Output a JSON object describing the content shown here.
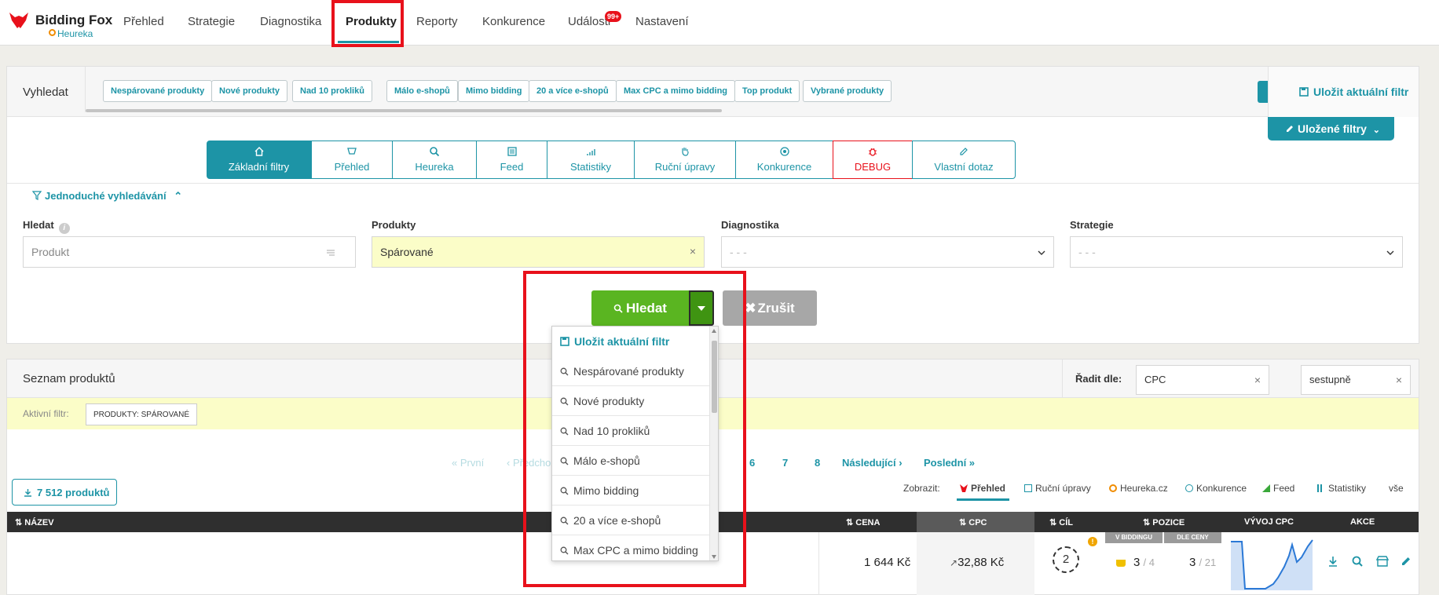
{
  "brand": {
    "name": "Bidding Fox",
    "sub": "Heureka",
    "color": "#e8111b"
  },
  "nav": {
    "items": [
      {
        "label": "Přehled"
      },
      {
        "label": "Strategie"
      },
      {
        "label": "Diagnostika"
      },
      {
        "label": "Produkty"
      },
      {
        "label": "Reporty"
      },
      {
        "label": "Konkurence"
      },
      {
        "label": "Události"
      },
      {
        "label": "Nastavení"
      }
    ],
    "active": "Produkty",
    "events_badge": "99+"
  },
  "search_strip": {
    "label": "Vyhledat",
    "chips": [
      "Nespárované produkty",
      "Nové produkty",
      "Nad 10 prokliků",
      "Málo e-shopů",
      "Mimo bidding",
      "20 a více e-shopů",
      "Max CPC a mimo bidding",
      "Top produkt",
      "Vybrané produkty"
    ],
    "save_filter": "Uložit aktuální filtr",
    "saved_filters": "Uložené filtry"
  },
  "filter_tabs": [
    {
      "label": "Základní filtry",
      "icon": "home-icon"
    },
    {
      "label": "Přehled",
      "icon": "overview-icon"
    },
    {
      "label": "Heureka",
      "icon": "heureka-icon"
    },
    {
      "label": "Feed",
      "icon": "feed-icon"
    },
    {
      "label": "Statistiky",
      "icon": "stats-icon"
    },
    {
      "label": "Ruční úpravy",
      "icon": "hand-icon"
    },
    {
      "label": "Konkurence",
      "icon": "competition-icon"
    },
    {
      "label": "DEBUG",
      "icon": "bug-icon"
    },
    {
      "label": "Vlastní dotaz",
      "icon": "pencil-icon"
    }
  ],
  "simple_search": "Jednoduché vyhledávání",
  "fields": {
    "hledat": {
      "label": "Hledat",
      "info": "i",
      "placeholder": "Produkt"
    },
    "produkty": {
      "label": "Produkty",
      "value": "Spárované",
      "clear": "×"
    },
    "diagnostika": {
      "label": "Diagnostika",
      "value": "- - -"
    },
    "strategie": {
      "label": "Strategie",
      "value": "- - -"
    }
  },
  "actions": {
    "search": "Hledat",
    "cancel": "Zrušit"
  },
  "dropdown": {
    "save": "Uložit aktuální filtr",
    "items": [
      "Nespárované produkty",
      "Nové produkty",
      "Nad 10 prokliků",
      "Málo e-shopů",
      "Mimo bidding",
      "20 a více e-shopů",
      "Max CPC a mimo bidding"
    ]
  },
  "list": {
    "title": "Seznam produktů",
    "sort_label": "Řadit dle:",
    "sort_field": "CPC",
    "sort_dir": "sestupně",
    "clear": "×",
    "active_filter_label": "Aktivní filtr:",
    "active_filter_tag": "PRODUKTY: SPÁROVANÉ",
    "pagination": {
      "first": "« První",
      "prev": "‹ Předchozí",
      "pages": [
        "6",
        "7",
        "8"
      ],
      "next": "Následující ›",
      "last": "Poslední »"
    },
    "count": "7 512 produktů",
    "show_label": "Zobrazit:",
    "show_options": [
      "Přehled",
      "Ruční úpravy",
      "Heureka.cz",
      "Konkurence",
      "Feed",
      "Statistiky",
      "vše"
    ],
    "columns": {
      "name": "NÁZEV",
      "price": "CENA",
      "cpc": "CPC",
      "goal": "CÍL",
      "position": "POZICE",
      "position_bidding": "V BIDDINGU",
      "position_price": "DLE CENY",
      "cpc_trend": "VÝVOJ CPC",
      "actions": "AKCE"
    },
    "row": {
      "price": "1 644 Kč",
      "cpc": "32,88 Kč",
      "goal": "2",
      "pos_bidding": "3",
      "pos_bidding_total": "/ 4",
      "pos_price": "3",
      "pos_price_total": "/ 21",
      "warning": "!"
    }
  }
}
